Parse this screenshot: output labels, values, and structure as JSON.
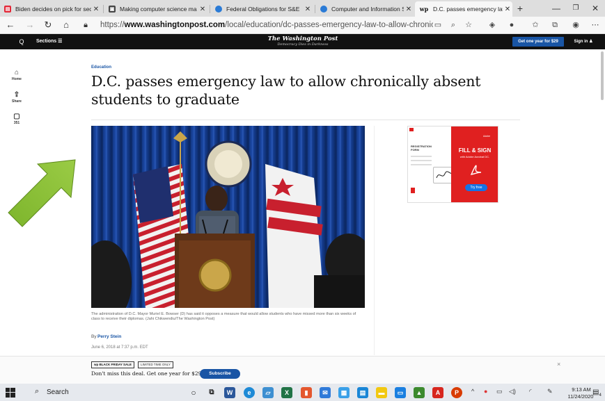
{
  "browser": {
    "tabs": [
      {
        "title": "Biden decides on pick for sec",
        "favicon_color": "#e32636",
        "favicon_glyph": "N",
        "active": false
      },
      {
        "title": "Making computer science ma",
        "favicon_color": "#444444",
        "favicon_glyph": "▣",
        "active": false
      },
      {
        "title": "Federal Obligations for S&E",
        "favicon_color": "#2b7bd6",
        "favicon_glyph": "●",
        "active": false
      },
      {
        "title": "Computer and Information Sc",
        "favicon_color": "#2b7bd6",
        "favicon_glyph": "●",
        "active": false
      },
      {
        "title": "D.C. passes emergency law to",
        "favicon_color": "#111111",
        "favicon_glyph": "wp",
        "active": true
      }
    ],
    "new_tab_label": "+",
    "url_prefix": "https://",
    "url_domain": "www.washingtonpost.com",
    "url_path": "/local/education/dc-passes-emergency-law-to-allow-chronically..."
  },
  "wapo_header": {
    "search_label": "Q",
    "sections_label": "Sections ☰",
    "logo": "The Washington Post",
    "tagline": "Democracy Dies in Darkness",
    "subscribe_label": "Get one year for $29",
    "signin_label": "Sign in ♟"
  },
  "rail": {
    "home": "Home",
    "share": "Share",
    "comments": "351"
  },
  "article": {
    "kicker": "Education",
    "headline": "D.C. passes emergency law to allow chronically absent students to graduate",
    "caption": "The administration of D.C. Mayor Muriel E. Bowser (D) has said it opposes a measure that would allow students who have missed more than six weeks of class to receive their diplomas. (Jahi Chikwendiu/The Washington Post)",
    "byline_prefix": "By",
    "author": "Perry Stein",
    "date": "June 6, 2018 at 7:37 p.m. EDT"
  },
  "ad": {
    "brand": "Adobe",
    "form_label": "REGISTRATION FORM",
    "title": "FILL & SIGN",
    "subtitle": "with Adobe Acrobat DC.",
    "cta": "Try free"
  },
  "promo": {
    "badge": "wp BLACK FRIDAY SALE",
    "limited": "LIMITED TIME ONLY",
    "text": "Don't miss this deal. Get one year for $29.",
    "button": "Subscribe",
    "close": "×"
  },
  "taskbar": {
    "search_placeholder": "Search",
    "time": "9:13 AM",
    "date": "11/24/2020",
    "notification_count": "4"
  }
}
